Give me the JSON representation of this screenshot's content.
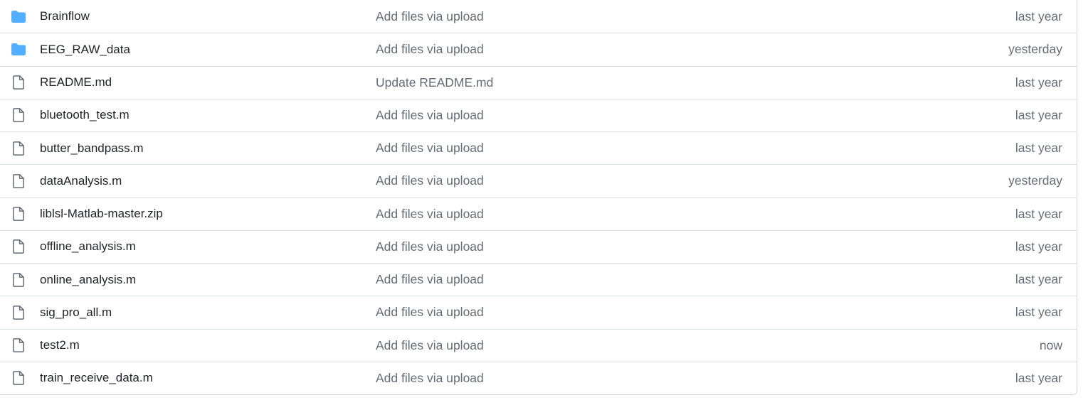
{
  "colors": {
    "folder_icon": "#54aeff",
    "file_icon": "#656d76",
    "text": "#1f2328",
    "muted": "#656d76",
    "border": "#d8dee4"
  },
  "rows": [
    {
      "name": "Brainflow",
      "type": "folder",
      "icon": "folder-icon",
      "commit": "Add files via upload",
      "age": "last year"
    },
    {
      "name": "EEG_RAW_data",
      "type": "folder",
      "icon": "folder-icon",
      "commit": "Add files via upload",
      "age": "yesterday"
    },
    {
      "name": "README.md",
      "type": "file",
      "icon": "file-icon",
      "commit": "Update README.md",
      "age": "last year"
    },
    {
      "name": "bluetooth_test.m",
      "type": "file",
      "icon": "file-icon",
      "commit": "Add files via upload",
      "age": "last year"
    },
    {
      "name": "butter_bandpass.m",
      "type": "file",
      "icon": "file-icon",
      "commit": "Add files via upload",
      "age": "last year"
    },
    {
      "name": "dataAnalysis.m",
      "type": "file",
      "icon": "file-icon",
      "commit": "Add files via upload",
      "age": "yesterday"
    },
    {
      "name": "liblsl-Matlab-master.zip",
      "type": "file",
      "icon": "file-icon",
      "commit": "Add files via upload",
      "age": "last year"
    },
    {
      "name": "offline_analysis.m",
      "type": "file",
      "icon": "file-icon",
      "commit": "Add files via upload",
      "age": "last year"
    },
    {
      "name": "online_analysis.m",
      "type": "file",
      "icon": "file-icon",
      "commit": "Add files via upload",
      "age": "last year"
    },
    {
      "name": "sig_pro_all.m",
      "type": "file",
      "icon": "file-icon",
      "commit": "Add files via upload",
      "age": "last year"
    },
    {
      "name": "test2.m",
      "type": "file",
      "icon": "file-icon",
      "commit": "Add files via upload",
      "age": "now"
    },
    {
      "name": "train_receive_data.m",
      "type": "file",
      "icon": "file-icon",
      "commit": "Add files via upload",
      "age": "last year"
    }
  ]
}
